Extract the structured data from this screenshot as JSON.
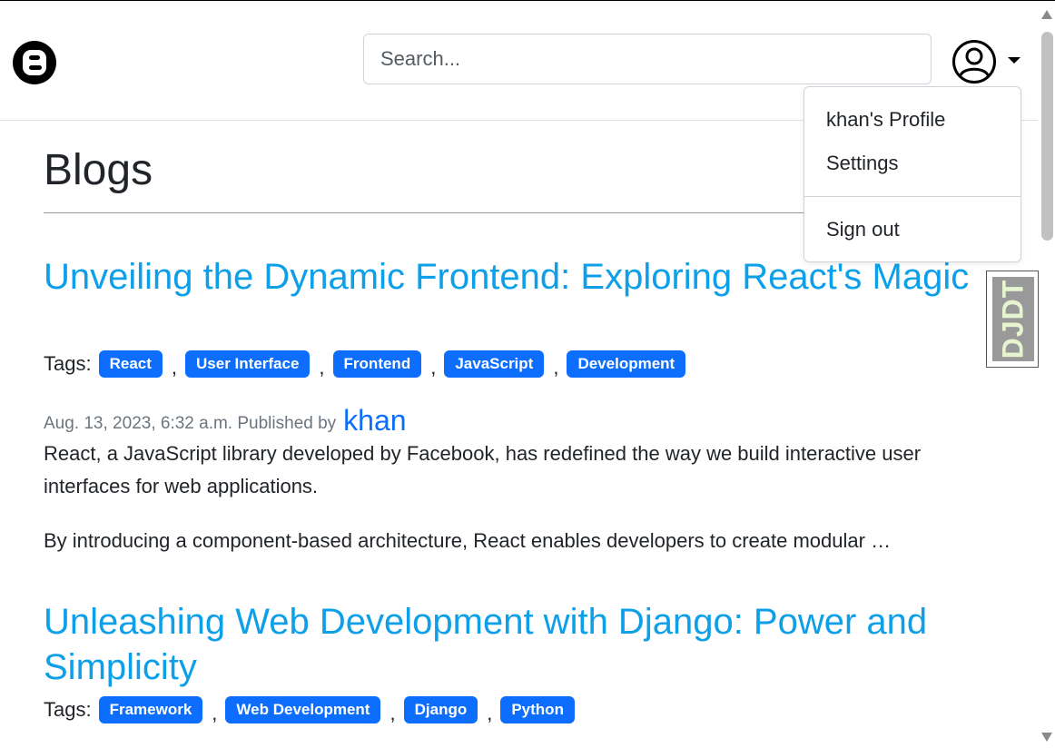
{
  "header": {
    "logo_icon": "blogger-b-icon",
    "search_placeholder": "Search...",
    "user_icon": "user-circle-icon"
  },
  "user_menu": {
    "items": [
      "khan's Profile",
      "Settings"
    ],
    "sign_out": "Sign out"
  },
  "debug_toolbar": {
    "label": "DJDT"
  },
  "main": {
    "title": "Blogs",
    "posts": [
      {
        "title": "Unveiling the Dynamic Frontend: Exploring React's Magic",
        "tags_label": "Tags:",
        "tags": [
          "React",
          "User Interface",
          "Frontend",
          "JavaScript",
          "Development"
        ],
        "date": "Aug. 13, 2023, 6:32 a.m.",
        "published_by": "Published by",
        "author": "khan",
        "excerpt1": "React, a JavaScript library developed by Facebook, has redefined the way we build interactive user interfaces for web applications.",
        "excerpt2": "By introducing a component-based architecture, React enables developers to create modular …"
      },
      {
        "title": "Unleashing Web Development with Django: Power and Simplicity",
        "tags_label": "Tags:",
        "tags": [
          "Framework",
          "Web Development",
          "Django",
          "Python"
        ]
      }
    ]
  },
  "colors": {
    "link": "#0d9fe8",
    "tag_bg": "#0d6efd",
    "author": "#0d6efd",
    "muted": "#6c757d"
  }
}
